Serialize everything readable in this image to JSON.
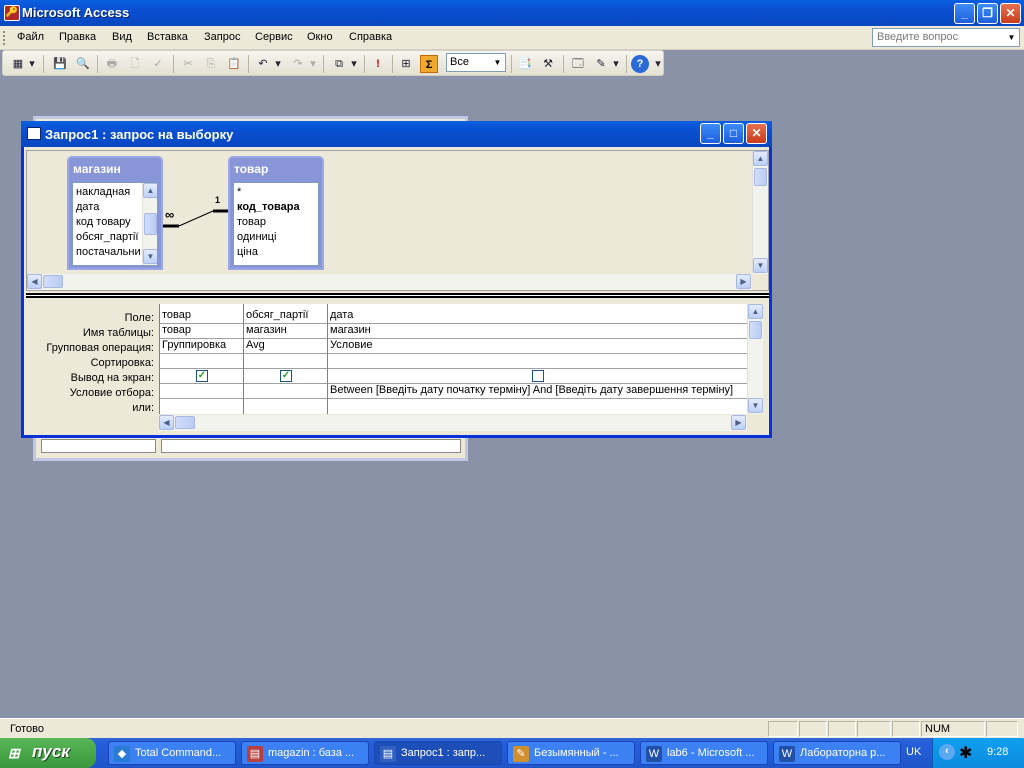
{
  "app": {
    "title": "Microsoft Access",
    "icon_glyph": "🔑",
    "window_buttons": {
      "minimize": "_",
      "maximize": "❐",
      "close": "✕"
    }
  },
  "menu": {
    "items": [
      "Файл",
      "Правка",
      "Вид",
      "Вставка",
      "Запрос",
      "Сервис",
      "Окно",
      "Справка"
    ],
    "help_placeholder": "Введите вопрос",
    "help_dropdown_glyph": "▼"
  },
  "toolbar": {
    "top_values": "Все",
    "top_values_dropdown_glyph": "▼",
    "icons": {
      "view": "▦",
      "view_dd": "▾",
      "save": "💾",
      "search": "🔍",
      "print": "🖶",
      "preview": "🗋",
      "spell": "✓",
      "cut": "✂",
      "copy": "⎘",
      "paste": "📋",
      "undo": "↶",
      "undo_dd": "▾",
      "redo": "↷",
      "redo_dd": "▾",
      "query_type": "⧉",
      "query_type_dd": "▾",
      "run": "!",
      "show_table": "⊞",
      "totals": "Σ",
      "properties": "📑",
      "builder": "⚒",
      "db_window": "🗔",
      "new_object": "✎",
      "new_object_dd": "▾",
      "help": "?",
      "options_dd": "▾"
    }
  },
  "query_window": {
    "title": "Запрос1 : запрос на выборку",
    "window_buttons": {
      "minimize": "_",
      "maximize": "□",
      "close": "✕"
    },
    "tables": [
      {
        "name": "магазин",
        "fields": [
          "накладная",
          "дата",
          "код товару",
          "обсяг_партії",
          "постачальни"
        ]
      },
      {
        "name": "товар",
        "fields": [
          "*",
          "код_товара",
          "товар",
          "одиниці",
          "ціна"
        ]
      }
    ],
    "relationship": {
      "many_label": "∞",
      "one_label": "1"
    },
    "grid": {
      "row_labels": [
        "Поле:",
        "Имя таблицы:",
        "Групповая операция:",
        "Сортировка:",
        "Вывод на экран:",
        "Условие отбора:",
        "или:"
      ],
      "columns": [
        {
          "field": "товар",
          "table": "товар",
          "total": "Группировка",
          "sort": "",
          "show": true,
          "criteria": ""
        },
        {
          "field": "обсяг_партії",
          "table": "магазин",
          "total": "Avg",
          "sort": "",
          "show": true,
          "criteria": ""
        },
        {
          "field": "дата",
          "table": "магазин",
          "total": "Условие",
          "sort": "",
          "show": false,
          "criteria": "Between [Введіть дату початку терміну] And [Введіть дату завершення терміну]"
        }
      ],
      "check_glyph": "✓"
    },
    "scroll_glyphs": {
      "up": "▲",
      "down": "▼",
      "left": "◀",
      "right": "▶"
    }
  },
  "statusbar": {
    "text": "Готово",
    "num": "NUM"
  },
  "taskbar": {
    "start": "пуск",
    "start_glyph": "⊞",
    "tasks": [
      {
        "label": "Total Command...",
        "glyph": "◆",
        "color": "#2a7ad8",
        "active": false
      },
      {
        "label": "magazin : база ...",
        "glyph": "▤",
        "color": "#b84040",
        "active": false
      },
      {
        "label": "Запрос1 : запр...",
        "glyph": "▤",
        "color": "#3060c0",
        "active": true
      },
      {
        "label": "Безымянный - ...",
        "glyph": "✎",
        "color": "#d09030",
        "active": false
      },
      {
        "label": "lab6 - Microsoft ...",
        "glyph": "W",
        "color": "#2050a8",
        "active": false
      },
      {
        "label": "Лабораторна р...",
        "glyph": "W",
        "color": "#2050a8",
        "active": false
      }
    ],
    "language": "UK",
    "tray_glyphs": {
      "arrow": "‹",
      "bug": "✱"
    },
    "clock": "9:28"
  }
}
